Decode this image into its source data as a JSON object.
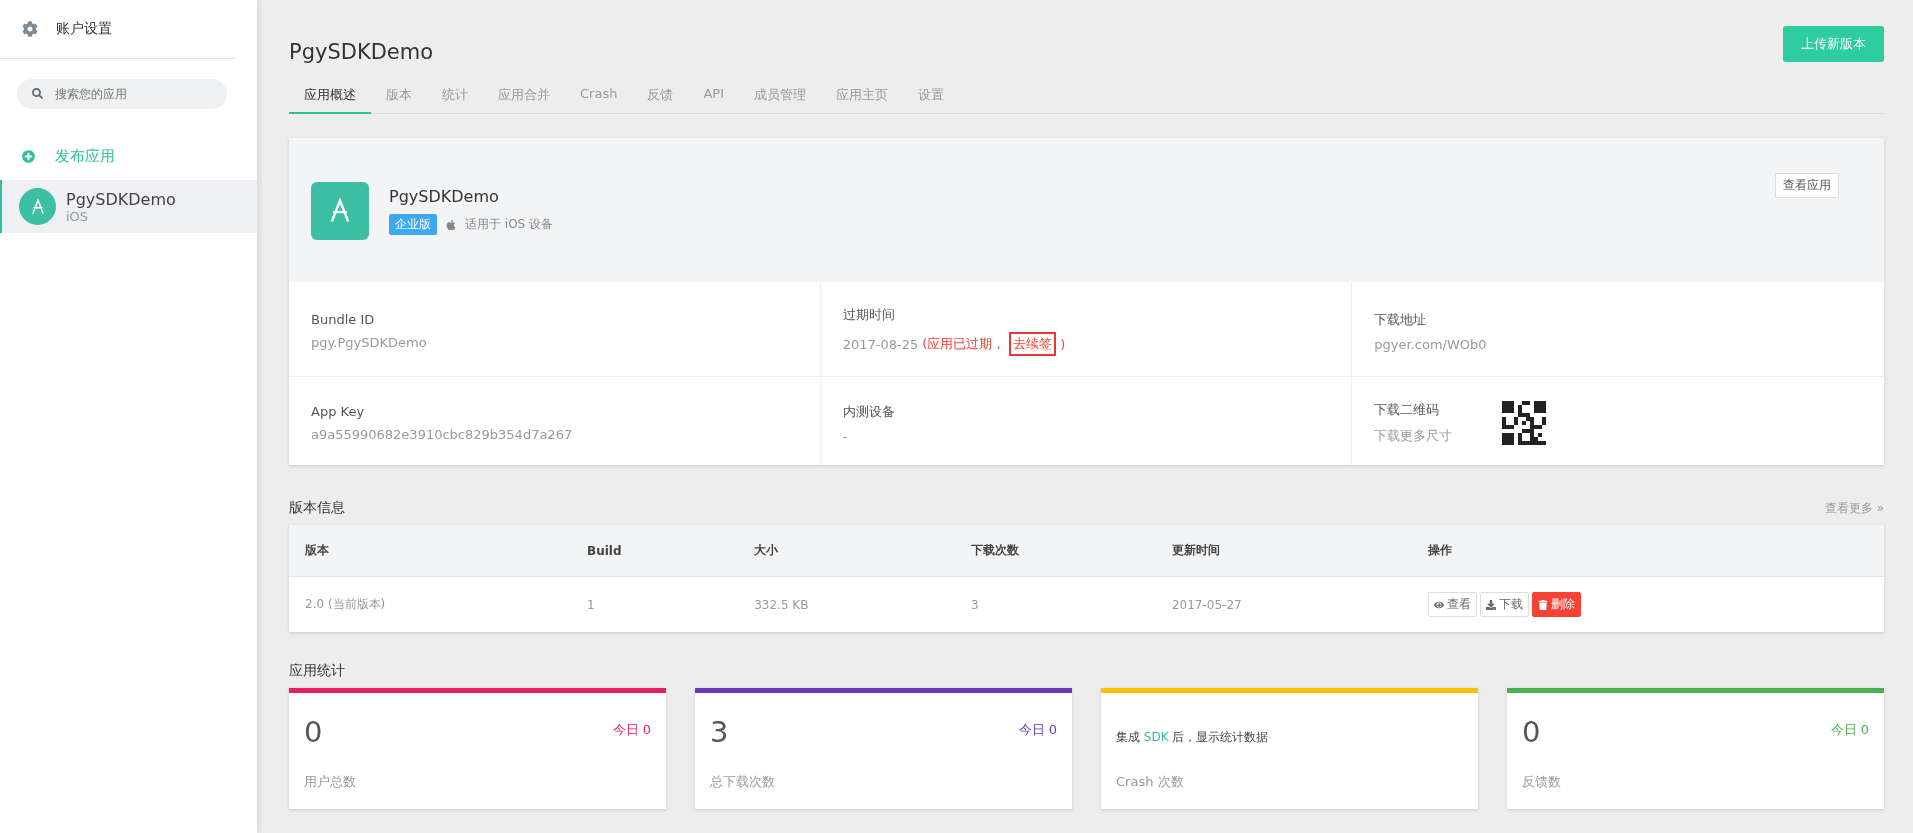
{
  "sidebar": {
    "settings_label": "账户设置",
    "search": {
      "placeholder": "搜索您的应用"
    },
    "publish_label": "发布应用",
    "apps": [
      {
        "name": "PgySDKDemo",
        "platform": "iOS",
        "selected": true
      }
    ]
  },
  "header": {
    "title": "PgySDKDemo",
    "upload_button": "上传新版本"
  },
  "tabs": [
    {
      "label": "应用概述",
      "selected": true
    },
    {
      "label": "版本",
      "selected": false
    },
    {
      "label": "统计",
      "selected": false
    },
    {
      "label": "应用合并",
      "selected": false
    },
    {
      "label": "Crash",
      "selected": false
    },
    {
      "label": "反馈",
      "selected": false
    },
    {
      "label": "API",
      "selected": false
    },
    {
      "label": "成员管理",
      "selected": false
    },
    {
      "label": "应用主页",
      "selected": false
    },
    {
      "label": "设置",
      "selected": false
    }
  ],
  "app_card": {
    "name": "PgySDKDemo",
    "badge": "企业版",
    "platform_note": "适用于 iOS 设备",
    "view_button": "查看应用",
    "info": [
      {
        "kind": "text",
        "label": "Bundle ID",
        "value": "pgy.PgySDKDemo"
      },
      {
        "kind": "expiry",
        "label": "过期时间",
        "value": "2017-08-25",
        "note": "(应用已过期，",
        "link": "去续签",
        "close": ")"
      },
      {
        "kind": "text",
        "label": "下载地址",
        "value": "pgyer.com/WOb0"
      },
      {
        "kind": "text",
        "label": "App Key",
        "value": "a9a55990682e3910cbc829b354d7a267"
      },
      {
        "kind": "text",
        "label": "内测设备",
        "value": "-"
      },
      {
        "kind": "qr",
        "label": "下载二维码",
        "value": "下载更多尺寸"
      }
    ]
  },
  "versions": {
    "title": "版本信息",
    "more_link": "查看更多 »",
    "columns": [
      "版本",
      "Build",
      "大小",
      "下载次数",
      "更新时间",
      "操作"
    ],
    "rows": [
      {
        "cells": [
          "2.0 (当前版本)",
          "1",
          "332.5 KB",
          "3",
          "2017-05-27"
        ],
        "actions": [
          {
            "kind": "view",
            "label": "查看"
          },
          {
            "kind": "download",
            "label": "下载"
          },
          {
            "kind": "delete",
            "label": "删除"
          }
        ]
      }
    ]
  },
  "stats": {
    "title": "应用统计",
    "cards": [
      {
        "kind": "count",
        "color": "#e91e63",
        "value": "0",
        "today": "今日 0",
        "label": "用户总数"
      },
      {
        "kind": "count",
        "color": "#673ab7",
        "value": "3",
        "today": "今日 0",
        "label": "总下载次数"
      },
      {
        "kind": "message",
        "color": "#ffc107",
        "before": "集成 ",
        "highlight": "SDK",
        "after": " 后，显示统计数据",
        "label": "Crash 次数"
      },
      {
        "kind": "count",
        "color": "#4caf50",
        "value": "0",
        "today": "今日 0",
        "label": "反馈数"
      }
    ]
  }
}
